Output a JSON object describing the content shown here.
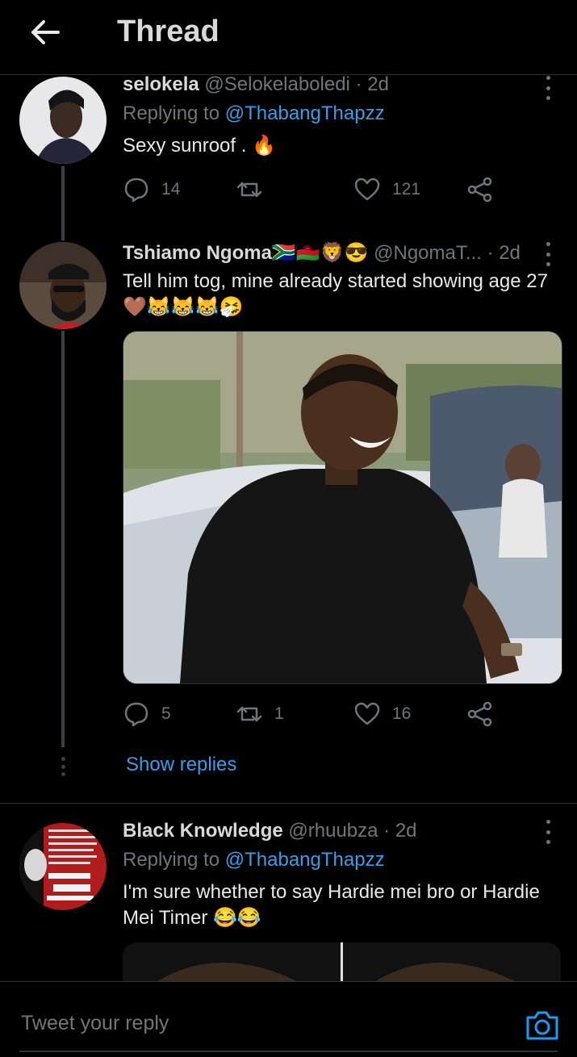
{
  "header": {
    "title": "Thread",
    "back_icon": "arrow-left-icon"
  },
  "tweets": [
    {
      "name": "selokela",
      "handle": "@Selokelaboledi",
      "dot": "·",
      "time": "2d",
      "replying_prefix": "Replying to",
      "replying_to": "@ThabangThapzz",
      "text": "Sexy sunroof . 🔥",
      "replies": "14",
      "retweets": "",
      "likes": "121"
    },
    {
      "name": "Tshiamo Ngoma🇿🇦🇲🇼🦁😎",
      "handle": "@NgomaT...",
      "dot": "·",
      "time": "2d",
      "text": "Tell him tog, mine already started showing age 27 🤎😹😹😹🤧",
      "replies": "5",
      "retweets": "1",
      "likes": "16"
    },
    {
      "name": "Black Knowledge",
      "handle": "@rhuubza",
      "dot": "·",
      "time": "2d",
      "replying_prefix": "Replying to",
      "replying_to": "@ThabangThapzz",
      "text": "I'm sure whether to say Hardie mei bro or Hardie Mei Timer  😂😂"
    }
  ],
  "show_replies": "Show replies",
  "composer": {
    "placeholder": "Tweet your reply",
    "camera_icon": "camera-icon"
  },
  "colors": {
    "accent": "#1d9bf0",
    "background": "#000000",
    "muted": "#6e767d"
  }
}
